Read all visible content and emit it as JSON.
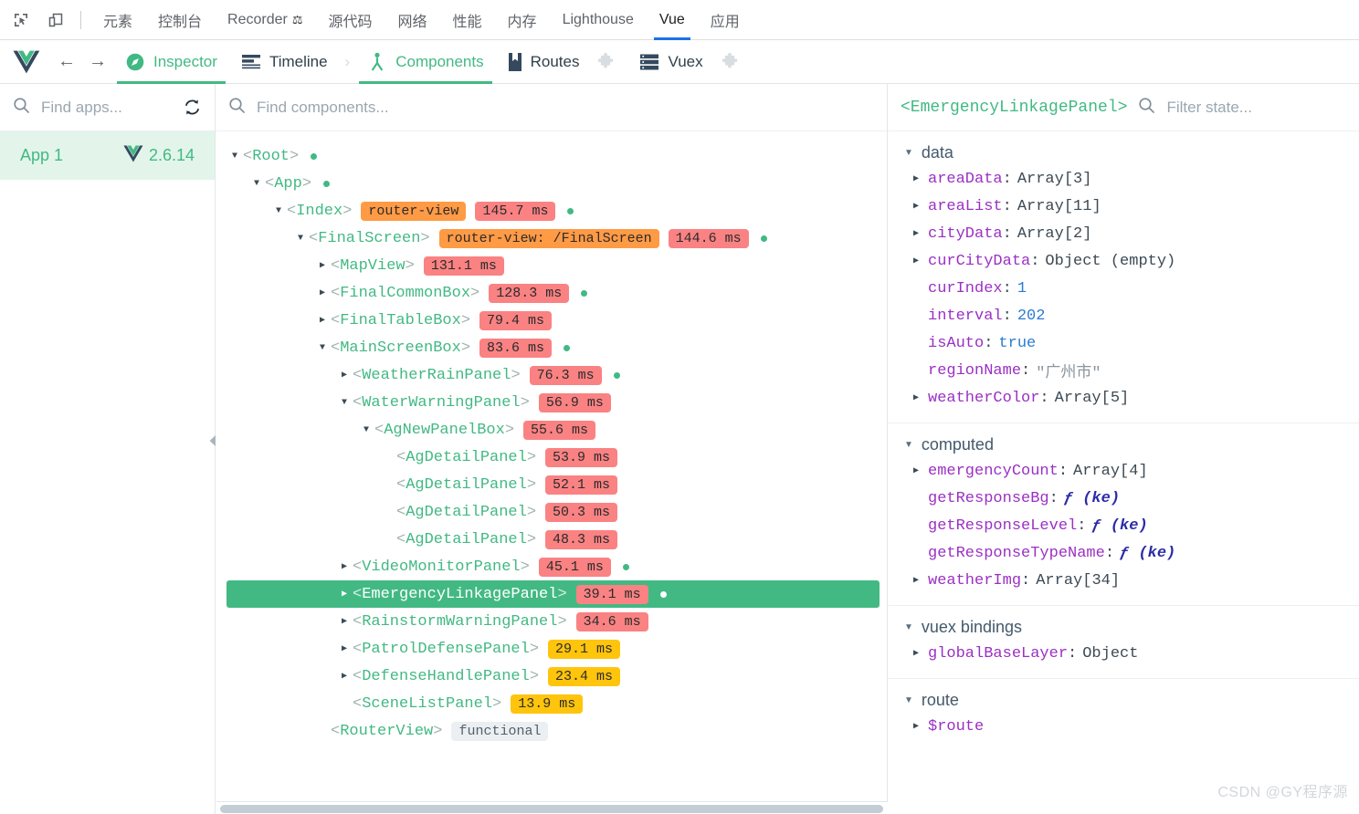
{
  "devtools_tabs": {
    "icons": [
      {
        "name": "inspect-element-icon",
        "label": "Inspect element"
      },
      {
        "name": "device-toolbar-icon",
        "label": "Toggle device toolbar"
      }
    ],
    "items": [
      {
        "label": "元素",
        "active": false,
        "icon": null
      },
      {
        "label": "控制台",
        "active": false,
        "icon": null
      },
      {
        "label": "Recorder",
        "active": false,
        "icon": "flask-icon"
      },
      {
        "label": "源代码",
        "active": false,
        "icon": null
      },
      {
        "label": "网络",
        "active": false,
        "icon": null
      },
      {
        "label": "性能",
        "active": false,
        "icon": null
      },
      {
        "label": "内存",
        "active": false,
        "icon": null
      },
      {
        "label": "Lighthouse",
        "active": false,
        "icon": null
      },
      {
        "label": "Vue",
        "active": true,
        "icon": null
      },
      {
        "label": "应用",
        "active": false,
        "icon": null
      }
    ]
  },
  "vue_nav": {
    "logo": "vue-logo-icon",
    "back_label": "←",
    "forward_label": "→",
    "tabs": [
      {
        "label": "Inspector",
        "icon": "compass-icon",
        "active": true,
        "puzzle": false
      },
      {
        "label": "Timeline",
        "icon": "timeline-icon",
        "active": false,
        "puzzle": false
      },
      {
        "separator": "›"
      },
      {
        "label": "Components",
        "icon": "components-icon",
        "active": true,
        "puzzle": false
      },
      {
        "label": "Routes",
        "icon": "book-icon",
        "active": false,
        "puzzle": true
      },
      {
        "label": "Vuex",
        "icon": "store-icon",
        "active": false,
        "puzzle": true
      }
    ]
  },
  "apps_panel": {
    "search": {
      "placeholder": "Find apps...",
      "value": "",
      "icon": "search-icon"
    },
    "refresh_icon": "refresh-icon",
    "selected_app": {
      "name": "App 1",
      "version": "2.6.14",
      "logo": "vue-mini-logo-icon"
    }
  },
  "tree_panel": {
    "search": {
      "placeholder": "Find components...",
      "value": "",
      "icon": "search-icon"
    },
    "collapse_handle_icon": "chevron-left-icon",
    "rows": [
      {
        "depth": 0,
        "caret": "open",
        "name": "<Root>",
        "tags": [],
        "dot": true,
        "selected": false
      },
      {
        "depth": 1,
        "caret": "open",
        "name": "<App>",
        "tags": [],
        "dot": true,
        "selected": false
      },
      {
        "depth": 2,
        "caret": "open",
        "name": "<Index>",
        "tags": [
          {
            "text": "router-view",
            "style": "router"
          },
          {
            "text": "145.7 ms",
            "style": "red"
          }
        ],
        "dot": true,
        "selected": false
      },
      {
        "depth": 3,
        "caret": "open",
        "name": "<FinalScreen>",
        "tags": [
          {
            "text": "router-view: /FinalScreen",
            "style": "router"
          },
          {
            "text": "144.6 ms",
            "style": "red"
          }
        ],
        "dot": true,
        "selected": false
      },
      {
        "depth": 4,
        "caret": "closed",
        "name": "<MapView>",
        "tags": [
          {
            "text": "131.1 ms",
            "style": "red"
          }
        ],
        "dot": false,
        "selected": false
      },
      {
        "depth": 4,
        "caret": "closed",
        "name": "<FinalCommonBox>",
        "tags": [
          {
            "text": "128.3 ms",
            "style": "red"
          }
        ],
        "dot": true,
        "selected": false
      },
      {
        "depth": 4,
        "caret": "closed",
        "name": "<FinalTableBox>",
        "tags": [
          {
            "text": "79.4 ms",
            "style": "red"
          }
        ],
        "dot": false,
        "selected": false
      },
      {
        "depth": 4,
        "caret": "open",
        "name": "<MainScreenBox>",
        "tags": [
          {
            "text": "83.6 ms",
            "style": "red"
          }
        ],
        "dot": true,
        "selected": false
      },
      {
        "depth": 5,
        "caret": "closed",
        "name": "<WeatherRainPanel>",
        "tags": [
          {
            "text": "76.3 ms",
            "style": "red"
          }
        ],
        "dot": true,
        "selected": false
      },
      {
        "depth": 5,
        "caret": "open",
        "name": "<WaterWarningPanel>",
        "tags": [
          {
            "text": "56.9 ms",
            "style": "red"
          }
        ],
        "dot": false,
        "selected": false
      },
      {
        "depth": 6,
        "caret": "open",
        "name": "<AgNewPanelBox>",
        "tags": [
          {
            "text": "55.6 ms",
            "style": "red"
          }
        ],
        "dot": false,
        "selected": false
      },
      {
        "depth": 7,
        "caret": "none",
        "name": "<AgDetailPanel>",
        "tags": [
          {
            "text": "53.9 ms",
            "style": "red"
          }
        ],
        "dot": false,
        "selected": false
      },
      {
        "depth": 7,
        "caret": "none",
        "name": "<AgDetailPanel>",
        "tags": [
          {
            "text": "52.1 ms",
            "style": "red"
          }
        ],
        "dot": false,
        "selected": false
      },
      {
        "depth": 7,
        "caret": "none",
        "name": "<AgDetailPanel>",
        "tags": [
          {
            "text": "50.3 ms",
            "style": "red"
          }
        ],
        "dot": false,
        "selected": false
      },
      {
        "depth": 7,
        "caret": "none",
        "name": "<AgDetailPanel>",
        "tags": [
          {
            "text": "48.3 ms",
            "style": "red"
          }
        ],
        "dot": false,
        "selected": false
      },
      {
        "depth": 5,
        "caret": "closed",
        "name": "<VideoMonitorPanel>",
        "tags": [
          {
            "text": "45.1 ms",
            "style": "red"
          }
        ],
        "dot": true,
        "selected": false
      },
      {
        "depth": 5,
        "caret": "closed",
        "name": "<EmergencyLinkagePanel>",
        "tags": [
          {
            "text": "39.1 ms",
            "style": "red"
          }
        ],
        "dot": true,
        "selected": true
      },
      {
        "depth": 5,
        "caret": "closed",
        "name": "<RainstormWarningPanel>",
        "tags": [
          {
            "text": "34.6 ms",
            "style": "red"
          }
        ],
        "dot": false,
        "selected": false
      },
      {
        "depth": 5,
        "caret": "closed",
        "name": "<PatrolDefensePanel>",
        "tags": [
          {
            "text": "29.1 ms",
            "style": "yellow"
          }
        ],
        "dot": false,
        "selected": false
      },
      {
        "depth": 5,
        "caret": "closed",
        "name": "<DefenseHandlePanel>",
        "tags": [
          {
            "text": "23.4 ms",
            "style": "yellow"
          }
        ],
        "dot": false,
        "selected": false
      },
      {
        "depth": 5,
        "caret": "none",
        "name": "<SceneListPanel>",
        "tags": [
          {
            "text": "13.9 ms",
            "style": "yellow"
          }
        ],
        "dot": false,
        "selected": false
      },
      {
        "depth": 4,
        "caret": "none",
        "name": "<RouterView>",
        "tags": [
          {
            "text": "functional",
            "style": "gray"
          }
        ],
        "dot": false,
        "selected": false
      }
    ],
    "scrollbar": {
      "name": "horizontal-scrollbar"
    }
  },
  "state_panel": {
    "component_name": "<EmergencyLinkagePanel>",
    "search": {
      "placeholder": "Filter state...",
      "value": "",
      "icon": "search-icon"
    },
    "groups": [
      {
        "title": "data",
        "expanded": true,
        "rows": [
          {
            "expandable": true,
            "key": "areaData",
            "value": "Array[3]",
            "vtype": "type"
          },
          {
            "expandable": true,
            "key": "areaList",
            "value": "Array[11]",
            "vtype": "type"
          },
          {
            "expandable": true,
            "key": "cityData",
            "value": "Array[2]",
            "vtype": "type"
          },
          {
            "expandable": true,
            "key": "curCityData",
            "value": "Object (empty)",
            "vtype": "type"
          },
          {
            "expandable": false,
            "key": "curIndex",
            "value": "1",
            "vtype": "num"
          },
          {
            "expandable": false,
            "key": "interval",
            "value": "202",
            "vtype": "num"
          },
          {
            "expandable": false,
            "key": "isAuto",
            "value": "true",
            "vtype": "bool"
          },
          {
            "expandable": false,
            "key": "regionName",
            "value": "\"广州市\"",
            "vtype": "str"
          },
          {
            "expandable": true,
            "key": "weatherColor",
            "value": "Array[5]",
            "vtype": "type"
          }
        ]
      },
      {
        "title": "computed",
        "expanded": true,
        "rows": [
          {
            "expandable": true,
            "key": "emergencyCount",
            "value": "Array[4]",
            "vtype": "type"
          },
          {
            "expandable": false,
            "key": "getResponseBg",
            "value": "ƒ (ke)",
            "vtype": "fn"
          },
          {
            "expandable": false,
            "key": "getResponseLevel",
            "value": "ƒ (ke)",
            "vtype": "fn"
          },
          {
            "expandable": false,
            "key": "getResponseTypeName",
            "value": "ƒ (ke)",
            "vtype": "fn"
          },
          {
            "expandable": true,
            "key": "weatherImg",
            "value": "Array[34]",
            "vtype": "type"
          }
        ]
      },
      {
        "title": "vuex bindings",
        "expanded": true,
        "rows": [
          {
            "expandable": true,
            "key": "globalBaseLayer",
            "value": "Object",
            "vtype": "type"
          }
        ]
      },
      {
        "title": "route",
        "expanded": true,
        "rows": [
          {
            "expandable": true,
            "key": "$route",
            "value": "",
            "vtype": "type"
          }
        ]
      }
    ]
  },
  "watermark": "CSDN @GY程序源",
  "colors": {
    "vue_green": "#42b983",
    "selected_row_bg": "#42b983",
    "app_row_bg": "#e3f5ea",
    "tag_router": "#ff9a45",
    "tag_red": "#fa8283",
    "tag_yellow": "#ffc40c",
    "tag_gray": "#eceff1",
    "devtools_active_underline": "#1a73e8",
    "key_purple": "#9b30c4"
  }
}
